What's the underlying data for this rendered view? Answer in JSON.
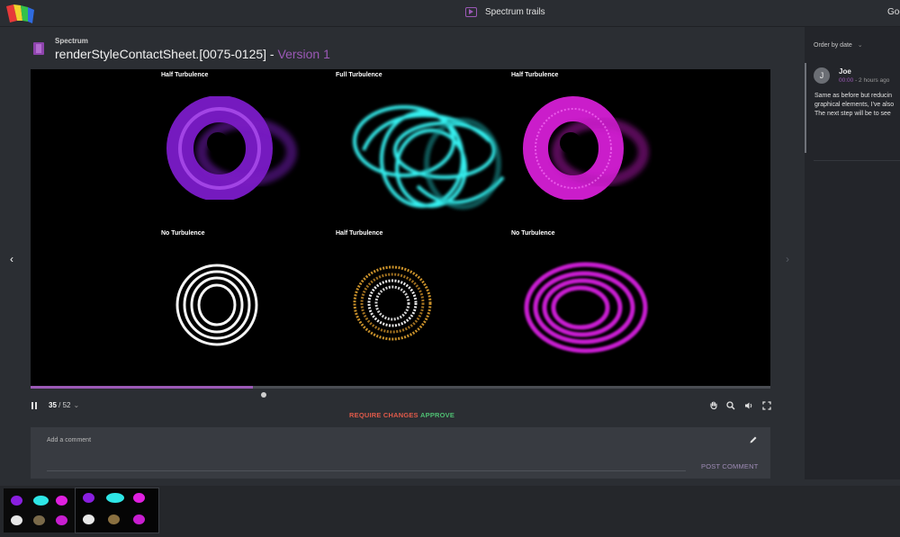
{
  "app": {
    "review_title": "Spectrum trails",
    "top_right_text": "Goo"
  },
  "header": {
    "project": "Spectrum",
    "asset_name": "renderStyleContactSheet.[0075-0125]",
    "separator": " - ",
    "version": "Version 1"
  },
  "viewer": {
    "cells": [
      {
        "label": "Half Turbulence",
        "color": "#a020f0"
      },
      {
        "label": "Full Turbulence",
        "color": "#2ee6e6"
      },
      {
        "label": "Half Turbulence",
        "color": "#e020e0"
      },
      {
        "label": "No Turbulence",
        "color": "#ffffff"
      },
      {
        "label": "Half Turbulence",
        "color": "#c8902a"
      },
      {
        "label": "No Turbulence",
        "color": "#c81ed0"
      }
    ],
    "nav_prev_icon": "chevron-left-icon",
    "nav_next_icon": "chevron-right-icon"
  },
  "playback": {
    "current_frame": "35",
    "frame_separator": " / ",
    "total_frames": "52",
    "progress": 0.3,
    "require_changes_label": "REQUIRE CHANGES",
    "approve_label": "APPROVE",
    "controls": [
      "hand-icon",
      "zoom-icon",
      "volume-icon",
      "fullscreen-icon"
    ]
  },
  "comment_box": {
    "placeholder": "Add a comment",
    "post_label": "POST COMMENT"
  },
  "comments_panel": {
    "order_label": "Order by date",
    "comments": [
      {
        "initial": "J",
        "author": "Joe",
        "timecode": "00:00",
        "time_ago": " - 2 hours ago",
        "lines": [
          "Same as before but reducin",
          "graphical elements, I've also",
          "The next step will be to see"
        ]
      }
    ]
  },
  "colors": {
    "accent": "#9b59b6",
    "require_changes": "#e05a4a",
    "approve": "#4fbf73"
  }
}
